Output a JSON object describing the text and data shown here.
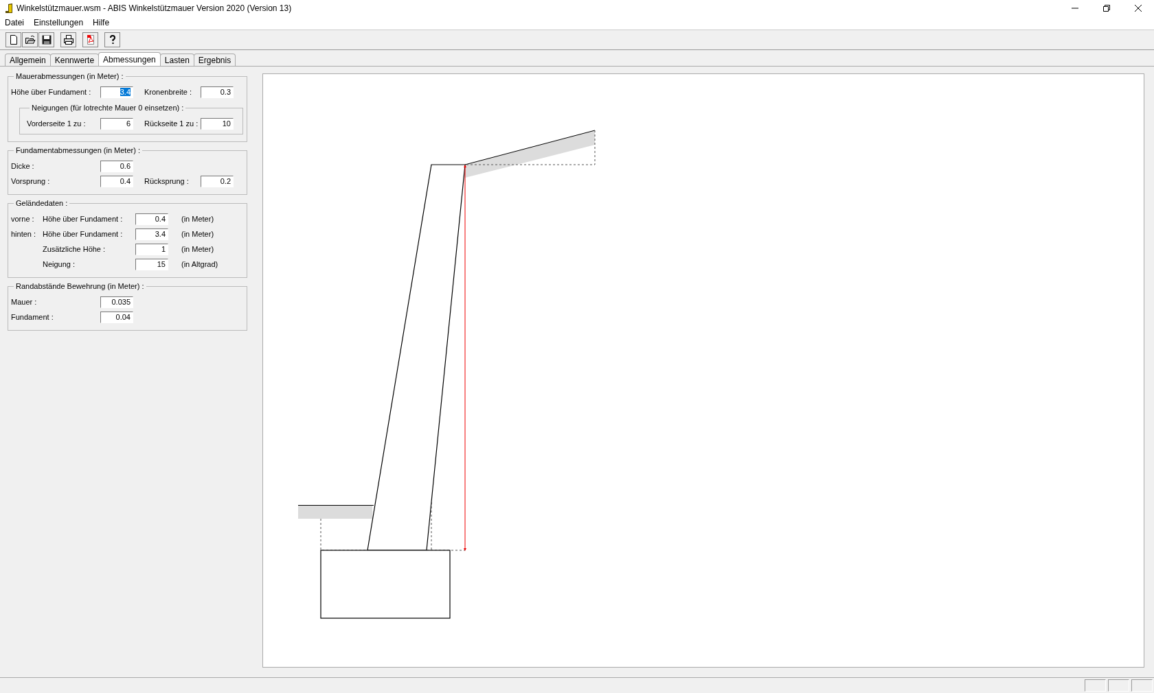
{
  "window": {
    "title": "Winkelstützmauer.wsm - ABIS Winkelstützmauer Version 2020 (Version 13)"
  },
  "menu": [
    "Datei",
    "Einstellungen",
    "Hilfe"
  ],
  "tabs": [
    {
      "label": "Allgemein",
      "selected": false
    },
    {
      "label": "Kennwerte",
      "selected": false
    },
    {
      "label": "Abmessungen",
      "selected": true
    },
    {
      "label": "Lasten",
      "selected": false
    },
    {
      "label": "Ergebnis",
      "selected": false
    }
  ],
  "groups": [
    {
      "title": "Mauerabmessungen (in Meter) :",
      "kind": "pair",
      "rows": [
        {
          "cells": [
            {
              "label": "Höhe über Fundament :",
              "value": "3.4",
              "highlighted": true
            },
            {
              "label": "Kronenbreite :",
              "value": "0.3",
              "highlighted": false
            }
          ]
        }
      ],
      "subgroup": {
        "title": "Neigungen (für lotrechte Mauer 0 einsetzen) :",
        "rows": [
          {
            "cells": [
              {
                "label": "Vorderseite 1 zu :",
                "value": "6",
                "highlighted": false
              },
              {
                "label": "Rückseite 1 zu :",
                "value": "10",
                "highlighted": false
              }
            ]
          }
        ]
      }
    },
    {
      "title": "Fundamentabmessungen (in Meter) :",
      "kind": "pair",
      "rows": [
        {
          "cells": [
            {
              "label": "Dicke :",
              "value": "0.6",
              "highlighted": false
            }
          ]
        },
        {
          "cells": [
            {
              "label": "Vorsprung :",
              "value": "0.4",
              "highlighted": false
            },
            {
              "label": "Rücksprung :",
              "value": "0.2",
              "highlighted": false
            }
          ]
        }
      ]
    },
    {
      "title": "Geländedaten :",
      "kind": "terrain",
      "rows": [
        {
          "prefix": "vorne :",
          "cells": [
            {
              "label": "Höhe über Fundament :",
              "value": "0.4",
              "highlighted": false
            }
          ],
          "unit": "(in Meter)"
        },
        {
          "prefix": "hinten :",
          "cells": [
            {
              "label": "Höhe über Fundament :",
              "value": "3.4",
              "highlighted": false
            }
          ],
          "unit": "(in Meter)"
        },
        {
          "cells": [
            {
              "label": "Zusätzliche Höhe :",
              "value": "1",
              "highlighted": false
            }
          ],
          "unit": "(in Meter)"
        },
        {
          "cells": [
            {
              "label": "Neigung :",
              "value": "15",
              "highlighted": false
            }
          ],
          "unit": "(in Altgrad)"
        }
      ]
    },
    {
      "title": "Randabstände Bewehrung (in Meter) :",
      "kind": "pair",
      "rows": [
        {
          "cells": [
            {
              "label": "Mauer :",
              "value": "0.035",
              "highlighted": false
            }
          ]
        },
        {
          "cells": [
            {
              "label": "Fundament :",
              "value": "0.04",
              "highlighted": false
            }
          ]
        }
      ]
    }
  ]
}
